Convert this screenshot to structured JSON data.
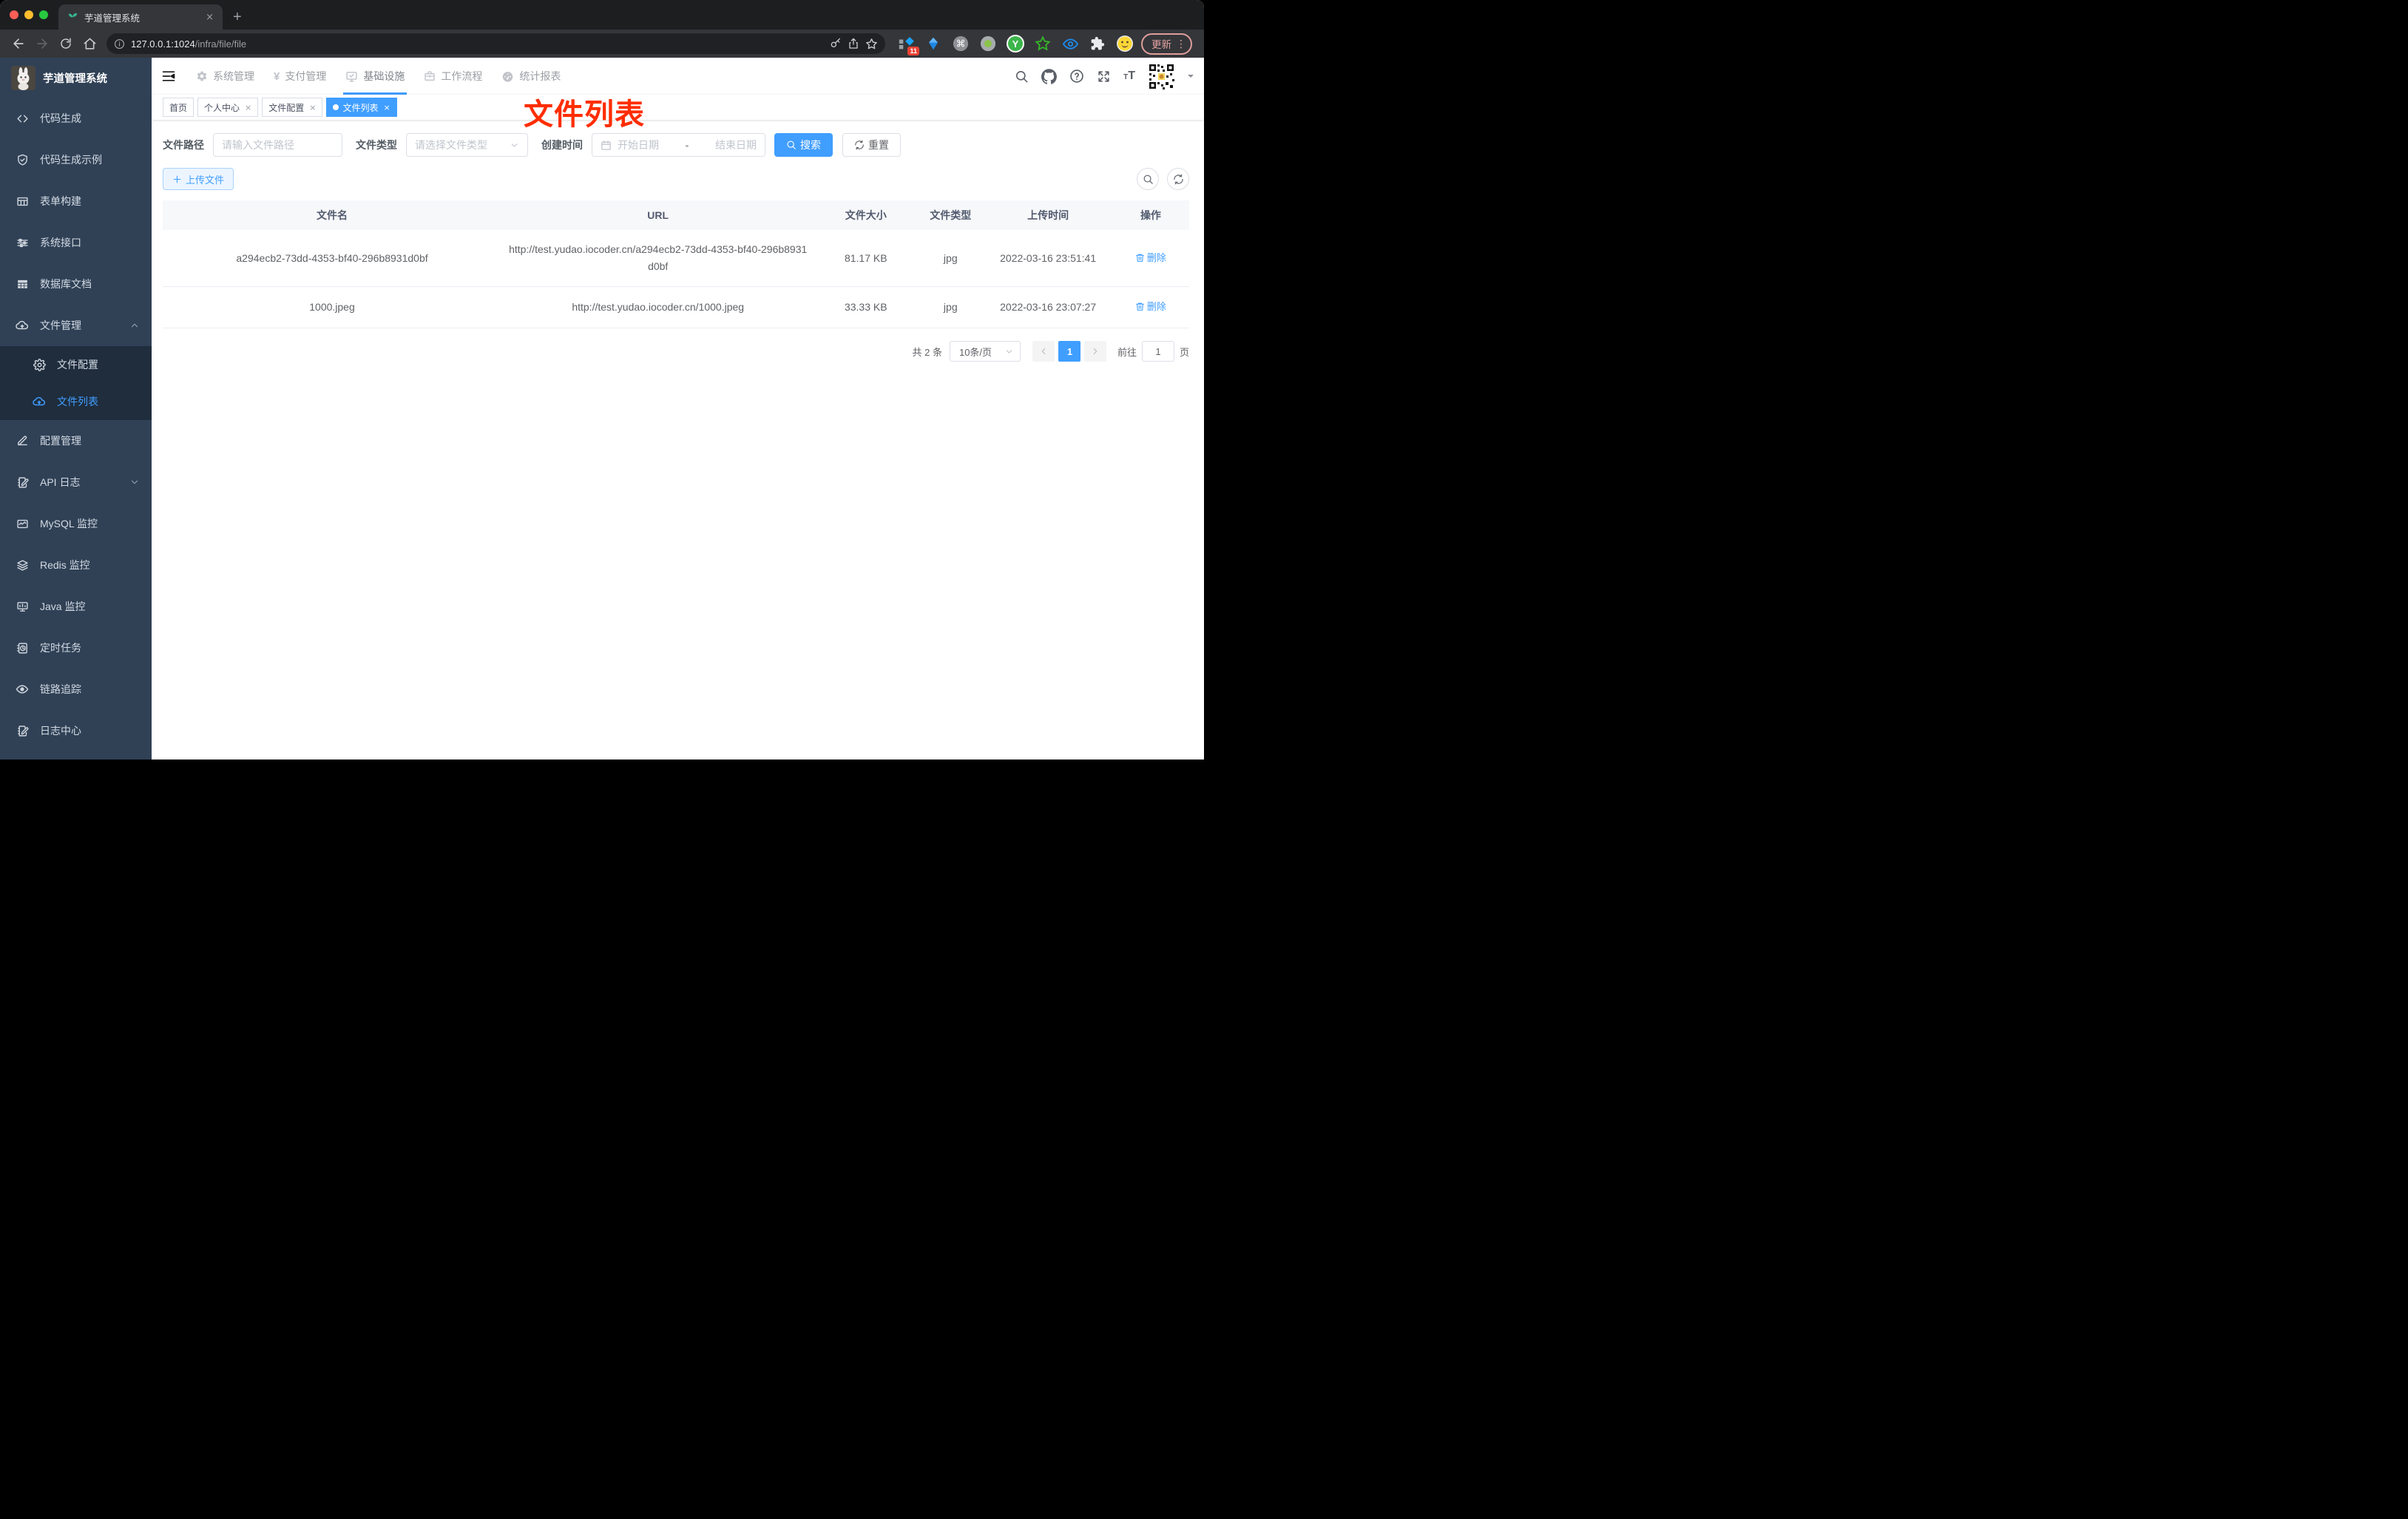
{
  "browser": {
    "tab_title": "芋道管理系统",
    "url_host": "127.0.0.1:1024",
    "url_path": "/infra/file/file",
    "update_label": "更新",
    "extension_badge": "11"
  },
  "app": {
    "title": "芋道管理系统",
    "annotation": "文件列表",
    "top_menu": [
      {
        "label": "系统管理"
      },
      {
        "label": "支付管理"
      },
      {
        "label": "基础设施"
      },
      {
        "label": "工作流程"
      },
      {
        "label": "统计报表"
      }
    ],
    "sidebar": [
      {
        "label": "代码生成"
      },
      {
        "label": "代码生成示例"
      },
      {
        "label": "表单构建"
      },
      {
        "label": "系统接口"
      },
      {
        "label": "数据库文档"
      },
      {
        "label": "文件管理",
        "children": [
          {
            "label": "文件配置"
          },
          {
            "label": "文件列表"
          }
        ]
      },
      {
        "label": "配置管理"
      },
      {
        "label": "API 日志"
      },
      {
        "label": "MySQL 监控"
      },
      {
        "label": "Redis 监控"
      },
      {
        "label": "Java 监控"
      },
      {
        "label": "定时任务"
      },
      {
        "label": "链路追踪"
      },
      {
        "label": "日志中心"
      }
    ],
    "tags": [
      {
        "label": "首页"
      },
      {
        "label": "个人中心"
      },
      {
        "label": "文件配置"
      },
      {
        "label": "文件列表"
      }
    ]
  },
  "filters": {
    "path_label": "文件路径",
    "path_placeholder": "请输入文件路径",
    "type_label": "文件类型",
    "type_placeholder": "请选择文件类型",
    "date_label": "创建时间",
    "date_start": "开始日期",
    "date_separator": "-",
    "date_end": "结束日期",
    "search_label": "搜索",
    "reset_label": "重置"
  },
  "toolbar": {
    "upload_label": "上传文件"
  },
  "table": {
    "headers": [
      "文件名",
      "URL",
      "文件大小",
      "文件类型",
      "上传时间",
      "操作"
    ],
    "rows": [
      {
        "name": "a294ecb2-73dd-4353-bf40-296b8931d0bf",
        "url": "http://test.yudao.iocoder.cn/a294ecb2-73dd-4353-bf40-296b8931d0bf",
        "size": "81.17 KB",
        "type": "jpg",
        "time": "2022-03-16 23:51:41",
        "action": "删除"
      },
      {
        "name": "1000.jpeg",
        "url": "http://test.yudao.iocoder.cn/1000.jpeg",
        "size": "33.33 KB",
        "type": "jpg",
        "time": "2022-03-16 23:07:27",
        "action": "删除"
      }
    ]
  },
  "pagination": {
    "total": "共 2 条",
    "page_size": "10条/页",
    "current": "1",
    "goto_label": "前往",
    "goto_value": "1",
    "page_unit": "页"
  },
  "colors": {
    "accent": "#409eff",
    "sidebar_bg": "#304156",
    "submenu_bg": "#1f2d3d",
    "annotation_red": "#ff2d00",
    "tab_active_bg": "#409eff"
  }
}
